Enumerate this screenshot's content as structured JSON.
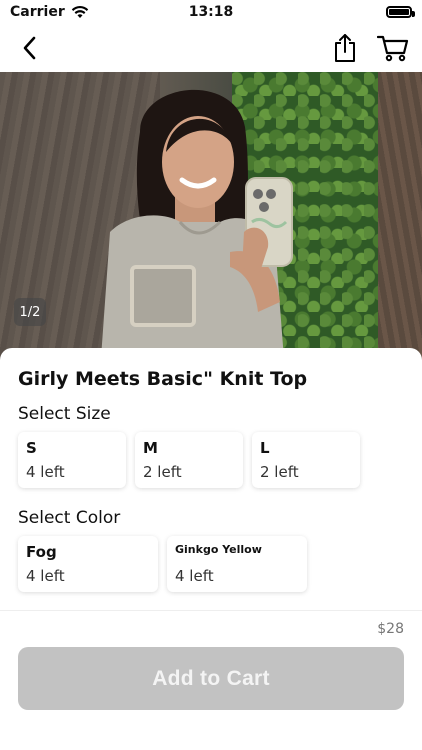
{
  "status_bar": {
    "carrier": "Carrier",
    "time": "13:18",
    "icons": [
      "wifi-icon",
      "battery-icon"
    ]
  },
  "nav": {
    "icons": [
      "back-chevron-icon",
      "share-icon",
      "cart-icon"
    ]
  },
  "hero": {
    "page_indicator": "1/2"
  },
  "product": {
    "title": "Girly Meets Basic\" Knit Top"
  },
  "size_section": {
    "label": "Select Size",
    "options": [
      {
        "name": "S",
        "stock": "4 left"
      },
      {
        "name": "M",
        "stock": "2 left"
      },
      {
        "name": "L",
        "stock": "2 left"
      }
    ]
  },
  "color_section": {
    "label": "Select Color",
    "options": [
      {
        "name": "Fog",
        "stock": "4 left"
      },
      {
        "name": "Ginkgo Yellow",
        "stock": "4 left"
      }
    ]
  },
  "footer": {
    "price": "$28",
    "add_to_cart_label": "Add to Cart",
    "button_color": "#c2c2c2"
  }
}
